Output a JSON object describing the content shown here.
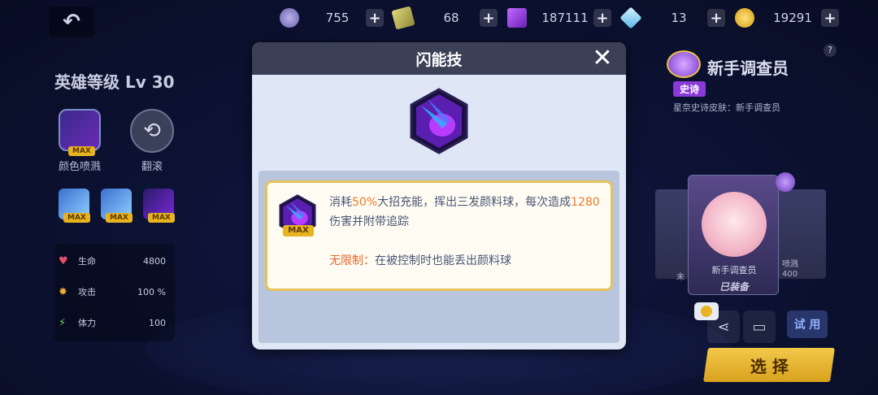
{
  "top_bar": {
    "resources": [
      {
        "name": "energy",
        "value": "755"
      },
      {
        "name": "ticket",
        "value": "68"
      },
      {
        "name": "purple-cube",
        "value": "187111"
      },
      {
        "name": "blue-diamond",
        "value": "13"
      },
      {
        "name": "gold-coin",
        "value": "19291"
      }
    ]
  },
  "left_panel": {
    "hero_level": "英雄等级 Lv 30",
    "skills": [
      {
        "label": "颜色喷溅",
        "badge": "MAX"
      },
      {
        "label": "翻滚"
      }
    ],
    "small_skills": [
      {
        "badge": "MAX"
      },
      {
        "badge": "MAX"
      },
      {
        "badge": "MAX"
      }
    ],
    "stats": [
      {
        "label": "生命",
        "value": "4800"
      },
      {
        "label": "攻击",
        "value": "100 %"
      },
      {
        "label": "体力",
        "value": "100"
      }
    ]
  },
  "right_panel": {
    "character_name": "新手调查员",
    "rarity": "史诗",
    "skin_label": "星奈史诗皮肤：新手调查员",
    "card_name": "新手调查员",
    "card_status": "已装备",
    "side_text_left": "未",
    "side_text_right_top": "喷溅",
    "side_text_right_bottom": "400",
    "help": "?",
    "try_label": "试 用",
    "select_label": "选 择"
  },
  "modal": {
    "title": "闪能技",
    "close": "✕",
    "max_badge": "MAX",
    "desc_line_prefix": "消耗",
    "desc_hl1": "50%",
    "desc_mid": "大招充能，挥出三发颜料球，每次造成",
    "desc_hl2": "1280",
    "desc_suffix": "伤害并附带追踪",
    "extra_label": "无限制：",
    "extra_text": "在被控制时也能丢出颜料球"
  },
  "colors": {
    "accent_orange": "#f07a2a",
    "max_badge": "#e8b31e",
    "modal_header": "#3c4057",
    "select_button": "#f3c84a"
  }
}
